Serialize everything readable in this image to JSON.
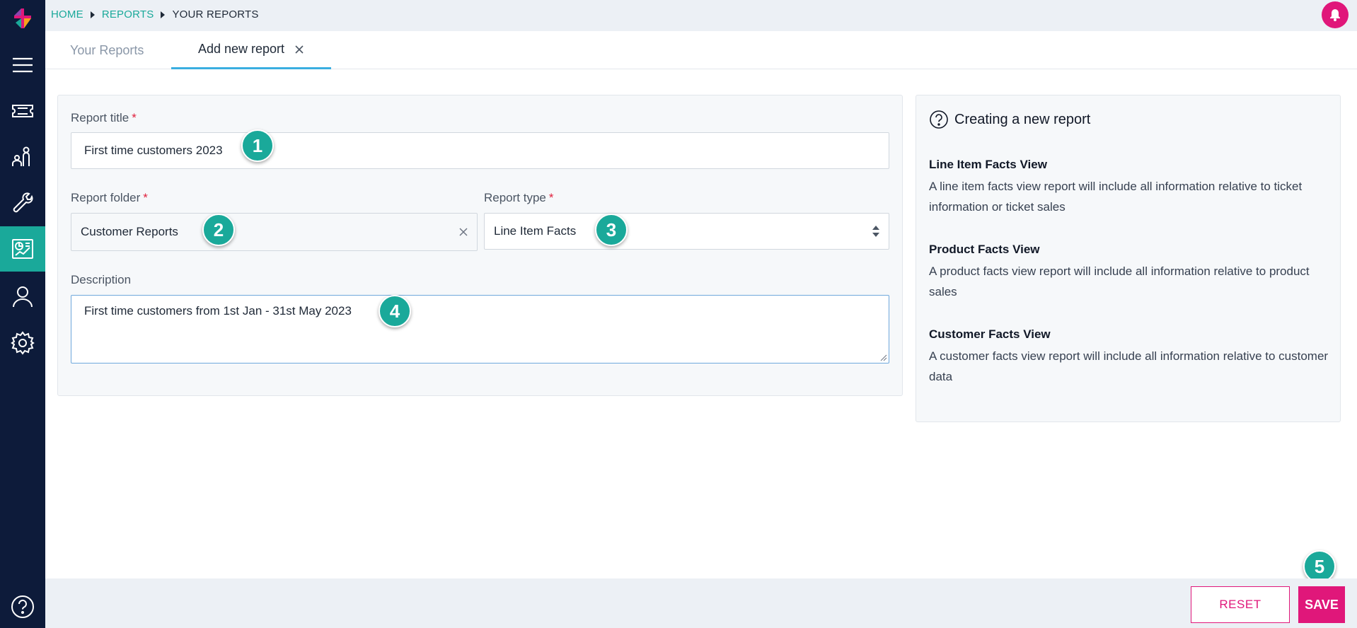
{
  "breadcrumb": {
    "home": "HOME",
    "reports": "REPORTS",
    "current": "YOUR REPORTS"
  },
  "tabs": {
    "your_reports": "Your Reports",
    "add_new": "Add new report"
  },
  "form": {
    "title_label": "Report title",
    "title_value": "First time customers 2023",
    "folder_label": "Report folder",
    "folder_value": "Customer Reports",
    "type_label": "Report type",
    "type_value": "Line Item Facts",
    "description_label": "Description",
    "description_value": "First time customers from 1st Jan - 31st May 2023",
    "required_mark": "*"
  },
  "steps": [
    "1",
    "2",
    "3",
    "4",
    "5"
  ],
  "help": {
    "title": "Creating a new report",
    "sections": [
      {
        "heading": "Line Item Facts View",
        "text": "A line item facts view report will include all information relative to ticket information or ticket sales"
      },
      {
        "heading": "Product Facts View",
        "text": "A product facts view report will include all information relative to product sales"
      },
      {
        "heading": "Customer Facts View",
        "text": "A customer facts view report will include all information relative to customer data"
      }
    ]
  },
  "footer": {
    "reset_label": "RESET",
    "save_label": "SAVE"
  },
  "icons": {
    "sidebar": [
      "menu-icon",
      "ticket-icon",
      "people-icon",
      "wrench-icon",
      "reports-icon",
      "user-icon",
      "gear-icon"
    ],
    "notifications": "bell-icon",
    "help": "help-icon"
  },
  "colors": {
    "sidebar": "#0d1b3a",
    "accent": "#1aa99a",
    "brand_pink": "#e0177a",
    "tab_underline": "#3aaee0"
  }
}
